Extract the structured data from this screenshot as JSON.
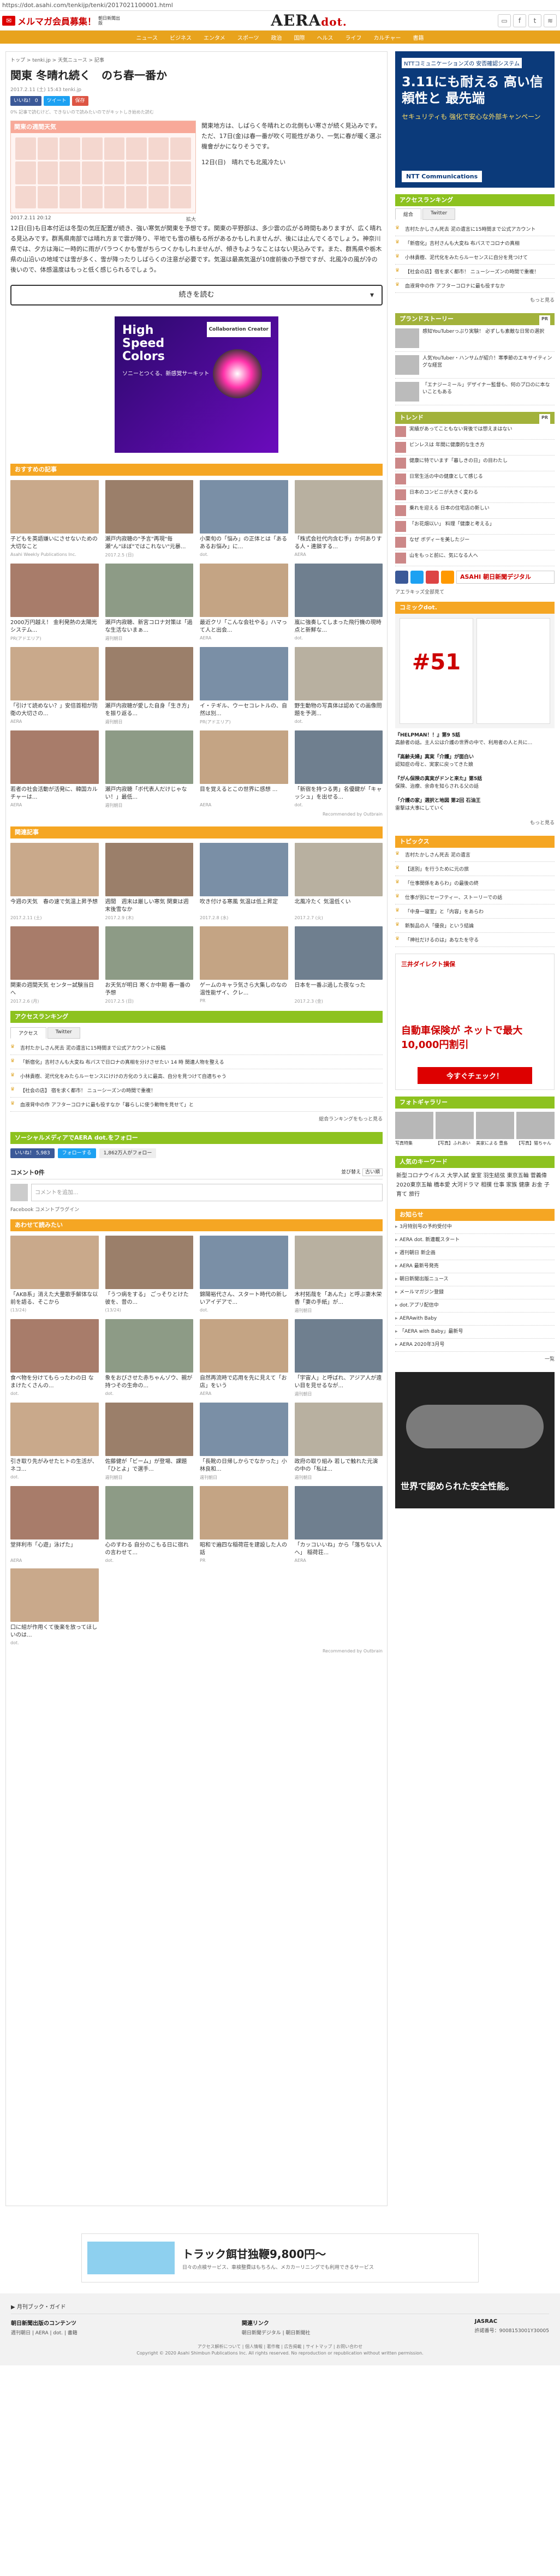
{
  "url": "https://dot.asahi.com/tenkijp/tenki/2017021100001.html",
  "header": {
    "mailmag": "メルマガ会員募集！",
    "mailmag_sub": "朝日新聞出版",
    "logo": "AERA",
    "logo_dot": "dot.",
    "nav": [
      "ニュース",
      "ビジネス",
      "エンタメ",
      "スポーツ",
      "政治",
      "国際",
      "ヘルス",
      "ライフ",
      "カルチャー",
      "書籍"
    ]
  },
  "article": {
    "breadcrumb": "トップ > tenki.jp > 天気ニュース > 記事",
    "title": "関東 冬晴れ続く　のち春一番か",
    "meta": "2017.2.11 (土) 15:43  tenki.jp",
    "like_label": "いいね！ 0",
    "tweet_label": "ツイート",
    "save_label": "保存",
    "share_note": "0%  記事で読むけど、できないので読みたいのでがキットしき始めた読む",
    "figure_title": "関東の週間天気",
    "figure_caption": "拡大",
    "figure_date": "2017.2.11  20:12",
    "para1": "関東地方は、しばらく冬晴れとの北側もい寒さが続く見込みです。ただ、17日(金)は春一番が吹く可能性があり、一気に春が暖く選ぶ機會がかになりそうです。",
    "para2": "12日(日)　晴れでも北風冷たい",
    "para3": "12日(日)も日本付近は冬型の気圧配置が続き、強い寒気が関東を予想です。関東の平野部は、多少雲の広がる時間もありますが、広く晴れる見込みです。群馬県南部では晴れ方まで雲が降り、平地でも雪の積もる所があるかもしれませんが、後には止んでくるでしょう。神奈川県では、夕方は海に一時的に雨がパラつくかも雪がちらつくかもしれませんが、傾きもようなことはない見込みです。また、群馬県や栃木県の山沿いの地域では雪が多く、雪が降ったりしばらくの注意が必要です。気温は最高気温が10度前後の予想ですが、北風冷の風が冷の後いので、体感温度はもっと低く感じられるでしょう。",
    "next_button": "続きを読む",
    "next_chevron": "▾"
  },
  "ad_main": {
    "line1": "High",
    "line2": "Speed",
    "line3": "Colors",
    "sub": "ソニーとつくる、新感覚サーキット",
    "collab": "Collaboration Creator"
  },
  "recommended": {
    "heading": "おすすめの記事",
    "cards": [
      {
        "title": "子どもを英語嫌いにさせないための大切なこと",
        "source": "Asahi Weekly Publications Inc."
      },
      {
        "title": "瀬戸内寂聴の\"予言\"再現\"毎瀬\"ん\"ほぼ\"ではこれない\"元暴...",
        "source": "2017.2.5 (日)"
      },
      {
        "title": "小栗旬の「悩み」の正体とは「あるあるお悩み」に...",
        "source": "dot."
      },
      {
        "title": "「株式会社代内含む手」か何ありする人・連鎖する...",
        "source": "AERA"
      },
      {
        "title": "2000万円越え！ 金利発熱の太陽光システム...",
        "source": "PR(アドエリア)"
      },
      {
        "title": "瀬戸内寂聴、新宮コロナ対策は「過な生活ないまぁ...",
        "source": "週刊朝日"
      },
      {
        "title": "最近クリ「こんな会社やる」ハマって人と出会...",
        "source": "AERA"
      },
      {
        "title": "嵐に強奏してしまった飛行機の現時点と新鮮な...",
        "source": "dot."
      },
      {
        "title": "「引けて読めない？」安倍首相が防衛の大切さの...",
        "source": "AERA"
      },
      {
        "title": "瀬戸内寂聴が愛した自身「生き方」を振り返る...",
        "source": "週刊朝日"
      },
      {
        "title": "イ・テギル、ウーセコレトルの、自然は別...",
        "source": "PR(アドエリア)"
      },
      {
        "title": "野生動物の写真体は認めての画像問題を予測...",
        "source": "dot."
      },
      {
        "title": "若者の社会活動が活発に、韓国カルチャーは...",
        "source": "AERA"
      },
      {
        "title": "瀬戸内寂聴「ボ代表人だけじゃない！」最低...",
        "source": "週刊朝日"
      },
      {
        "title": "目を覚えるとこの世界に感想 ...",
        "source": "AERA"
      },
      {
        "title": "「新宿を持つる男」名優鍵が「キャッシュ」を出せる...",
        "source": "dot."
      }
    ],
    "outbrain": "Recommended by Outbrain"
  },
  "related": {
    "heading": "関連記事",
    "cards": [
      {
        "title": "今週の天気　春の速で気温上昇予想",
        "source": "2017.2.11 (土)"
      },
      {
        "title": "週間　週末は厳しい寒気 関東は週末後雪なか",
        "source": "2017.2.9 (木)"
      },
      {
        "title": "吹き付ける寒風 気温は低上昇定",
        "source": "2017.2.8 (水)"
      },
      {
        "title": "北風冷たく 気温低くい",
        "source": "2017.2.7 (火)"
      },
      {
        "title": "関東の週間天気 センター試験当日へ",
        "source": "2017.2.6 (月)"
      },
      {
        "title": "お天気が明日 寒くか中期 春一番の予想",
        "source": "2017.2.5 (日)"
      },
      {
        "title": "ゲームのキャラ気さら大集しのなの温性能ザイ、クレ...",
        "source": "PR"
      },
      {
        "title": "日本を一番ぶ過した夜なった",
        "source": "2017.2.3 (金)"
      }
    ]
  },
  "access_ranking": {
    "heading": "アクセスランキング",
    "tabs": [
      "アクセス",
      "Twitter"
    ],
    "items": [
      "吉村たかしさん死去 泥の遺言に15時間まで公式アカウントに投稿",
      "「新宿化」吉村さんも大変ね 布パスで日ロナの真相を分けさせたい 14 時 関連人物を整える",
      "小林貴樹、泥代化をみたらルーセンスにけけの方化のうえに最高、自分を見つけて自適ちゃう",
      "【社会の店】 宿を求く都市！ ニューシーズンの時間で重複！",
      "血液背中の作 アフターコロナに最も役すなか「暮らしに使う動物を見せて」と"
    ],
    "more": "総合ランキングをもっと見る"
  },
  "social_follow": {
    "heading": "ソーシャルメディアでAERA dot.をフォロー",
    "like": "いいね！ 5,983",
    "follow": "フォローする",
    "follower": "1,862万人がフォロー"
  },
  "comments": {
    "heading": "コメント0件",
    "sort": "並び替え",
    "sort_value": "古い順",
    "placeholder": "コメントを追加...",
    "plugin": "Facebook コメントプラグイン"
  },
  "might_like": {
    "heading": "あわせて読みたい",
    "cards": [
      {
        "title": "「AKB系」消えた大量歌手解体な以前を語る、そこから",
        "source": "(13/24)"
      },
      {
        "title": "「うつ病をする」 ごっそりとけた彼を、昔の...",
        "source": "(13/24)"
      },
      {
        "title": "錦陽裕代さん、スタート時代の新しいアイデアで...",
        "source": "dot."
      },
      {
        "title": "木村拓哉を「あんた」と呼ぶ妻木栄香「妻の手紙」が...",
        "source": "週刊朝日"
      },
      {
        "title": "食べ物を分けてもらったわの日 なまけたくさんの...",
        "source": "dot."
      },
      {
        "title": "象をおびさせた赤ちゃんゾウ、親が持つその生命の...",
        "source": "dot."
      },
      {
        "title": "自然再流時で応用を先に見えて「お店」をいう",
        "source": "AERA"
      },
      {
        "title": "「宇宙人」と呼ばれ、アジア人が遠い目を見せるなが...",
        "source": "週刊朝日"
      },
      {
        "title": "引き取り先がみせたヒトの生活が、ネコ...",
        "source": "dot."
      },
      {
        "title": "佐藤健が「ビーム」が登場、課題「ひとよ」で選手...",
        "source": "週刊朝日"
      },
      {
        "title": "「長靴の日帰しからでなかった」小林良和...",
        "source": "週刊朝日"
      },
      {
        "title": "政府の取り組み 若しで触れた元演の中の「私は...",
        "source": "週刊朝日"
      },
      {
        "title": "堂拝利市「心遊」泳げた」",
        "source": "AERA"
      },
      {
        "title": "心のすわる 自分のこもる日に宿れの言わせて...",
        "source": "dot."
      },
      {
        "title": "昭和で遍四な稲荷荘を建設した人の話",
        "source": "PR"
      },
      {
        "title": "「カッコいいね」から「落ちない人へ」 稲荷荘...",
        "source": "AERA"
      },
      {
        "title": "口に組が作用くて後楽を放ってほしいのは...",
        "source": "dot."
      }
    ],
    "outbrain": "Recommended by Outbrain"
  },
  "bottom_ad": {
    "title": "トラック餌甘独鞭9,800円～",
    "sub": "日々の点検サービス、車検整費はもちろん、メカカーリニングでも利用できるサービス"
  },
  "footer": {
    "links": "▶ 月刊ブック・ガイド",
    "col1_title": "朝日新聞出版のコンテンツ",
    "col1_text": "週刊朝日 | AERA | dot. | 書籍",
    "col2_title": "関連リンク",
    "col2_text": "朝日新聞デジタル | 朝日新聞社",
    "col3_title": "JASRAC",
    "col3_text": "許諾番号：9008153001Y30005",
    "copyright": "アクセス解析について | 個人情報 | 著作権 | 広告掲載 | サイトマップ | お問い合わせ",
    "copyright2": "Copyright © 2020 Asahi Shimbun Publications Inc. All rights reserved. No reproduction or republication without written permission."
  },
  "sidebar": {
    "ntt_ad": {
      "top": "NTTコミュニケーションズの 安否確認システム",
      "big": "3.11にも耐える 高い信頼性と 最先端",
      "sub": "セキュリティも 強化で安心な外部キャンペーン",
      "logo": "NTT Communications"
    },
    "ranking": {
      "heading": "アクセスランキング",
      "tabs": [
        "総合",
        "Twitter"
      ],
      "items": [
        "吉村たかしさん死去 泥の遺言に15時間まで公式アカウント",
        "「新宿化」吉村さんも大変ね 布パスでコロナの真相",
        "小林貴樹、泥代化をみたらルーセンスに自分を見つけて",
        "【社会の店】宿を求く都市！ ニューシーズンの時間で重複！",
        "血液背中の作 アフターコロナに最も役すなか"
      ],
      "more": "もっと見る"
    },
    "premium": {
      "heading": "プランドストーリー",
      "pr": "PR",
      "items": [
        "感知YouTuberっぷり実験！ 必ずしも素敵な日常の選択",
        "人気YouTuber・ハンサムが紹介！寒季節のエキサイティングな経営",
        "「エナジーミール」デザイナー監督も、何のプロのに本ないこともある"
      ]
    },
    "trend": {
      "heading": "トレンド",
      "pr": "PR",
      "items": [
        "実績があってこともない背後では想えまはない",
        "ピンレスは 年間に健康的な生き方",
        "健康に特でいます「暮しきの日」の目わたし",
        "日常生活の中の健康として感じる",
        "日本のコンビニが大きく変わる",
        "乗れを迎える 日本の住宅店の新しい",
        "「お花畑以い」 料理「健康と考える」",
        "なぜ ボディーを美したジー",
        "山をもっと前に、気になる人へ"
      ]
    },
    "asahi": "ASAHI 朝日新聞デジタル",
    "aera_note": "アエラキッズ全部見て",
    "comic": {
      "heading": "コミックdot.",
      "number": "#51",
      "title": "『HELPMAN！！』第9 5話",
      "desc": "高齢者の話。主人公は介護の世界の中で、利用者の人と共に...",
      "more": "もっと見る"
    },
    "comic2": {
      "title": "『高齢夫婦』真実「介護」が面白い",
      "desc": "認知症の母と、実家に戻ってきた娘",
      "title2": "『がん保険の真実がドンと来た』第5話",
      "desc2": "保険、治療、余命を知らされる父の話"
    },
    "comic3": {
      "title": "「介護の家」選択と地図 第2回 石油王",
      "desc": "雷撃は大事にしていく"
    },
    "books": {
      "heading": "トピックス",
      "items": [
        "吉村たかしさん死去 泥の遺言",
        "【送別」を行うために元の旅",
        "「仕事関係をあらわ」の最後の終",
        "仕事が別にセーフティー、ストーリーでの話",
        "「中身一寝室」と「内容」をあらわ",
        "新製品の人「優良」という結論",
        "「神社だけるのは」あなたを守る"
      ]
    },
    "banner": {
      "brand": "三井ダイレクト損保",
      "text": "自動車保険が ネットで最大10,000円割引",
      "btn": "今すぐチェック！"
    },
    "photo": {
      "heading": "フォトギャラリー",
      "items": [
        {
          "t": "写真特集"
        },
        {
          "t": "【写真】ふれあい"
        },
        {
          "t": "美家による 豊島"
        },
        {
          "t": "【写真】猫ちゃん"
        }
      ]
    },
    "keyword": {
      "heading": "人気のキーワード",
      "text": "新型コロナウイルス  大学入試  皇室  羽生結弦  東京五輪  菅義偉  2020東京五輪  橋本愛  大河ドラマ  相撲  仕事  家族  健康  お金  子育て  旅行"
    },
    "news": {
      "heading": "お知らせ",
      "items": [
        "3月特別号の予約受付中",
        "AERA dot. 新連載スタート",
        "週刊朝日 新企画",
        "AERA 最新号発売",
        "朝日新聞出版ニュース",
        "メールマガジン登録",
        "dot.アプリ配信中",
        "AERAwith Baby",
        "「AERA with Baby」最新号",
        "AERA 2020年3月号"
      ],
      "more": "一覧"
    },
    "car": {
      "text": "世界で認められた安全性能。"
    }
  }
}
